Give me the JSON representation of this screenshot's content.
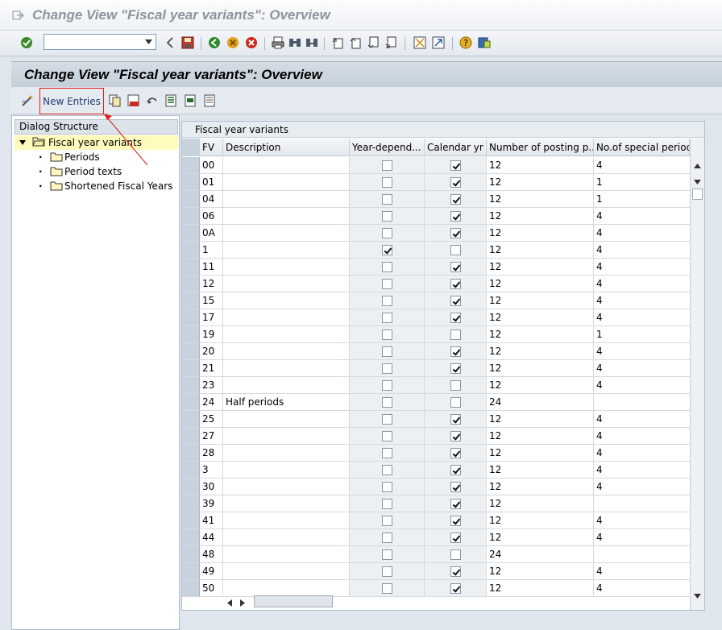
{
  "window": {
    "title": "Change View \"Fiscal year variants\": Overview"
  },
  "std_toolbar": {
    "command_field_value": ""
  },
  "header": {
    "title": "Change View \"Fiscal year variants\": Overview"
  },
  "app_toolbar": {
    "new_entries_label": "New Entries"
  },
  "dialog_structure": {
    "title": "Dialog Structure",
    "root": "Fiscal year variants",
    "children": [
      "Periods",
      "Period texts",
      "Shortened Fiscal Years"
    ]
  },
  "table": {
    "caption": "Fiscal year variants",
    "columns": [
      "FV",
      "Description",
      "Year-depend...",
      "Calendar yr",
      "Number of posting p...",
      "No.of special periods"
    ],
    "rows": [
      {
        "fv": "00",
        "desc": "",
        "yd": false,
        "cal": true,
        "post": "12",
        "spec": "4"
      },
      {
        "fv": "01",
        "desc": "",
        "yd": false,
        "cal": true,
        "post": "12",
        "spec": "1"
      },
      {
        "fv": "04",
        "desc": "",
        "yd": false,
        "cal": true,
        "post": "12",
        "spec": "1"
      },
      {
        "fv": "06",
        "desc": "",
        "yd": false,
        "cal": true,
        "post": "12",
        "spec": "4"
      },
      {
        "fv": "0A",
        "desc": "",
        "yd": false,
        "cal": true,
        "post": "12",
        "spec": "4"
      },
      {
        "fv": "1",
        "desc": "",
        "yd": true,
        "cal": false,
        "post": "12",
        "spec": "4"
      },
      {
        "fv": "11",
        "desc": "",
        "yd": false,
        "cal": true,
        "post": "12",
        "spec": "4"
      },
      {
        "fv": "12",
        "desc": "",
        "yd": false,
        "cal": true,
        "post": "12",
        "spec": "4"
      },
      {
        "fv": "15",
        "desc": "",
        "yd": false,
        "cal": true,
        "post": "12",
        "spec": "4"
      },
      {
        "fv": "17",
        "desc": "",
        "yd": false,
        "cal": true,
        "post": "12",
        "spec": "4"
      },
      {
        "fv": "19",
        "desc": "",
        "yd": false,
        "cal": false,
        "post": "12",
        "spec": "1"
      },
      {
        "fv": "20",
        "desc": "",
        "yd": false,
        "cal": true,
        "post": "12",
        "spec": "4"
      },
      {
        "fv": "21",
        "desc": "",
        "yd": false,
        "cal": true,
        "post": "12",
        "spec": "4"
      },
      {
        "fv": "23",
        "desc": "",
        "yd": false,
        "cal": false,
        "post": "12",
        "spec": "4"
      },
      {
        "fv": "24",
        "desc": "Half periods",
        "yd": false,
        "cal": false,
        "post": "24",
        "spec": ""
      },
      {
        "fv": "25",
        "desc": "",
        "yd": false,
        "cal": true,
        "post": "12",
        "spec": "4"
      },
      {
        "fv": "27",
        "desc": "",
        "yd": false,
        "cal": true,
        "post": "12",
        "spec": "4"
      },
      {
        "fv": "28",
        "desc": "",
        "yd": false,
        "cal": true,
        "post": "12",
        "spec": "4"
      },
      {
        "fv": "3",
        "desc": "",
        "yd": false,
        "cal": true,
        "post": "12",
        "spec": "4"
      },
      {
        "fv": "30",
        "desc": "",
        "yd": false,
        "cal": true,
        "post": "12",
        "spec": "4"
      },
      {
        "fv": "39",
        "desc": "",
        "yd": false,
        "cal": true,
        "post": "12",
        "spec": ""
      },
      {
        "fv": "41",
        "desc": "",
        "yd": false,
        "cal": true,
        "post": "12",
        "spec": "4"
      },
      {
        "fv": "44",
        "desc": "",
        "yd": false,
        "cal": true,
        "post": "12",
        "spec": "4"
      },
      {
        "fv": "48",
        "desc": "",
        "yd": false,
        "cal": false,
        "post": "24",
        "spec": ""
      },
      {
        "fv": "49",
        "desc": "",
        "yd": false,
        "cal": true,
        "post": "12",
        "spec": "4"
      },
      {
        "fv": "50",
        "desc": "",
        "yd": false,
        "cal": true,
        "post": "12",
        "spec": "4"
      }
    ]
  },
  "colors": {
    "highlight_box": "#e21a1a",
    "tree_selection": "#fffbbd"
  }
}
